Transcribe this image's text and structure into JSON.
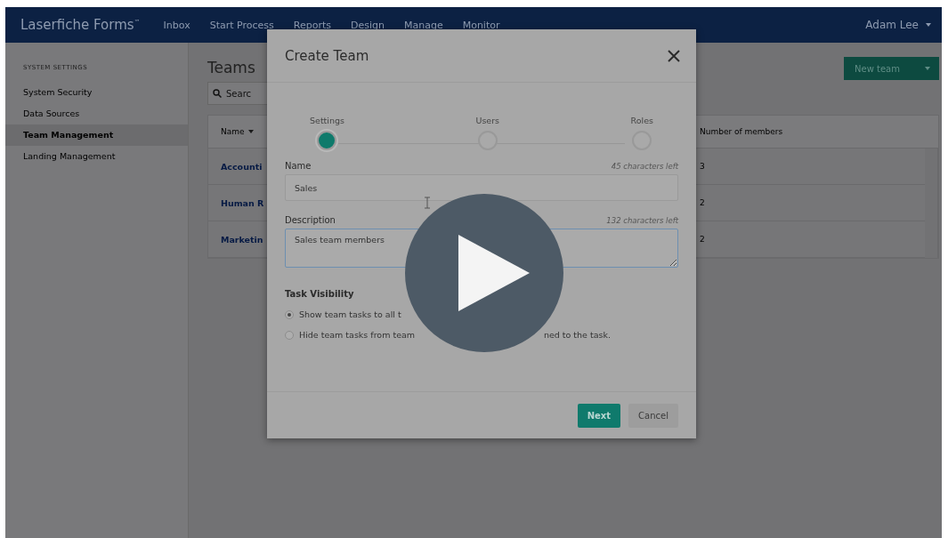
{
  "app": {
    "title": "Laserfiche Forms$^{™}$"
  },
  "nav": [
    {
      "label": "Inbox"
    },
    {
      "label": "Start Process"
    },
    {
      "label": "Reports"
    },
    {
      "label": "Design"
    },
    {
      "label": "Manage"
    },
    {
      "label": "Monitor"
    }
  ],
  "user": {
    "name": "Adam Lee"
  },
  "sidebar": {
    "heading": "SYSTEM SETTINGS",
    "items": [
      {
        "label": "System Security",
        "selected": false
      },
      {
        "label": "Data Sources",
        "selected": false
      },
      {
        "label": "Team Management",
        "selected": true
      },
      {
        "label": "Landing Management",
        "selected": false
      }
    ]
  },
  "page": {
    "title": "Teams",
    "search": {
      "placeholder": "Searc"
    },
    "new_button": {
      "label": "New team"
    }
  },
  "table": {
    "columns": [
      {
        "label": "Name"
      },
      {
        "label": "Number of members"
      }
    ],
    "rows": [
      {
        "name": "Accounti",
        "members": "3"
      },
      {
        "name": "Human R",
        "members": "2"
      },
      {
        "name": "Marketin",
        "members": "2"
      }
    ]
  },
  "dialog": {
    "title": "Create Team",
    "steps": [
      {
        "label": "Settings",
        "selected": true
      },
      {
        "label": "Users",
        "selected": false
      },
      {
        "label": "Roles",
        "selected": false
      }
    ],
    "name": {
      "label": "Name",
      "counter": "45 characters left",
      "value": "Sales"
    },
    "description": {
      "label": "Description",
      "counter": "132 characters left",
      "value": "Sales team members"
    },
    "visibility": {
      "label": "Task Visibility",
      "options": [
        {
          "texts": [
            "Show team tasks to all t"
          ],
          "selected": true
        },
        {
          "texts": [
            "Hide team tasks from team",
            "ned to the task."
          ],
          "selected": false
        }
      ]
    },
    "buttons": [
      {
        "label": "Next",
        "kind": "primary"
      },
      {
        "label": "Cancel",
        "kind": "secondary"
      }
    ]
  }
}
